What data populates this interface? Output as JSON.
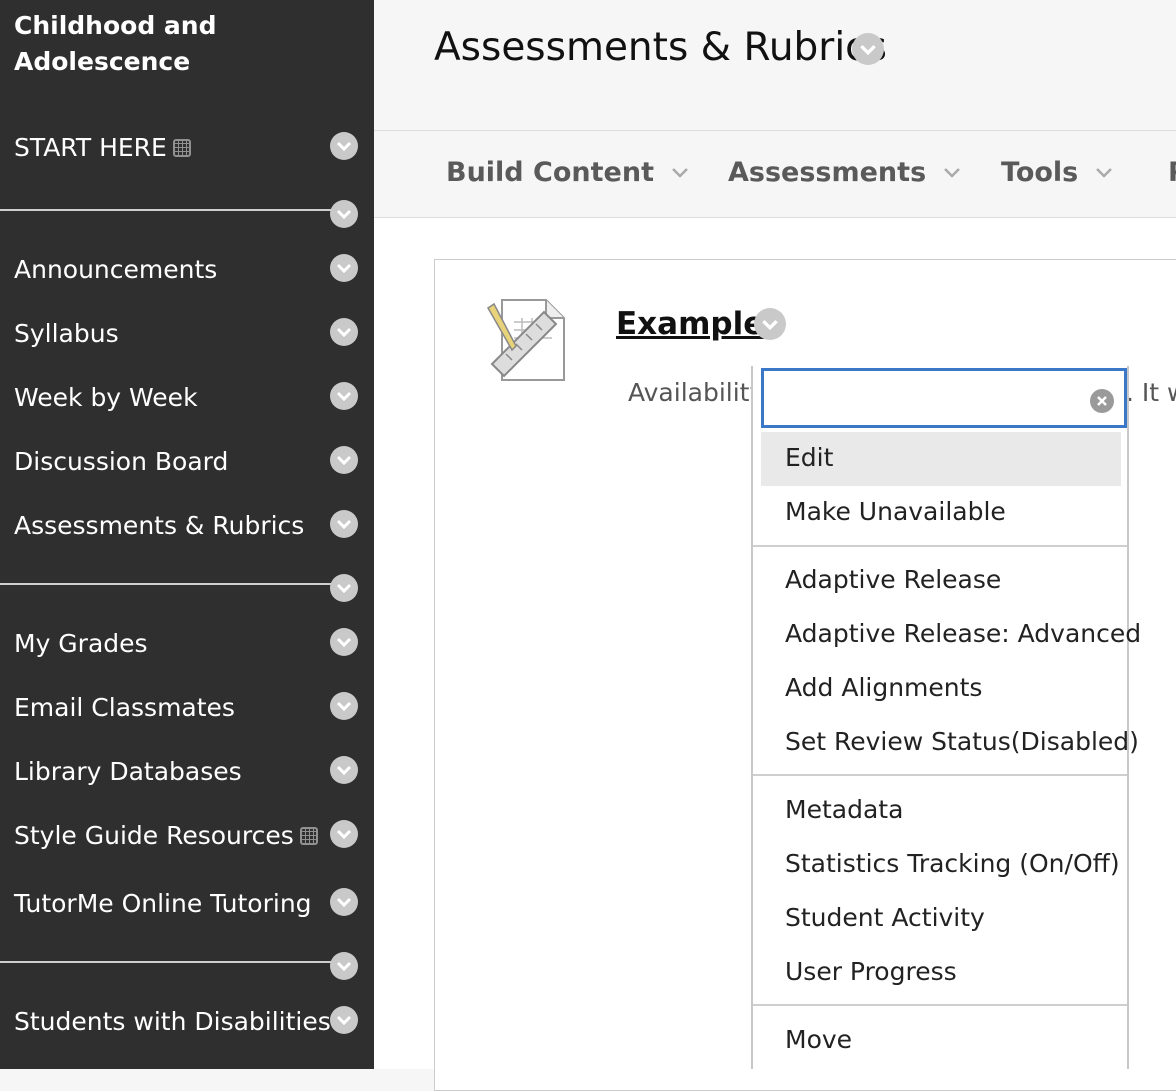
{
  "sidebar": {
    "course_title_line1": "Childhood and",
    "course_title_line2": "Adolescence",
    "items": [
      {
        "label": "START HERE"
      },
      {
        "label": "Announcements"
      },
      {
        "label": "Syllabus"
      },
      {
        "label": "Week by Week"
      },
      {
        "label": "Discussion Board"
      },
      {
        "label": "Assessments & Rubrics"
      },
      {
        "label": "My Grades"
      },
      {
        "label": "Email Classmates"
      },
      {
        "label": "Library Databases"
      },
      {
        "label": "Style Guide Resources"
      },
      {
        "label": "TutorMe Online Tutoring"
      },
      {
        "label": "Students with Disabilities"
      }
    ]
  },
  "header": {
    "title": "Assessments & Rubrics"
  },
  "toolbar": {
    "items": [
      {
        "label": "Build Content"
      },
      {
        "label": "Assessments"
      },
      {
        "label": "Tools"
      },
      {
        "label": "P"
      }
    ]
  },
  "content": {
    "item_title": "Example",
    "availability_text": "Availability",
    "availability_tail": ". It w"
  },
  "menu": {
    "search_value": "",
    "items": [
      {
        "label": "Edit"
      },
      {
        "label": "Make Unavailable"
      },
      {
        "label": "Adaptive Release"
      },
      {
        "label": "Adaptive Release: Advanced"
      },
      {
        "label": "Add Alignments"
      },
      {
        "label": "Set Review Status(Disabled)"
      },
      {
        "label": "Metadata"
      },
      {
        "label": "Statistics Tracking (On/Off)"
      },
      {
        "label": "Student Activity"
      },
      {
        "label": "User Progress"
      },
      {
        "label": "Move"
      }
    ]
  },
  "colors": {
    "sidebar_bg": "#2f2f2f",
    "focus_border": "#3b78c8",
    "highlight": "#e9e9e9"
  }
}
